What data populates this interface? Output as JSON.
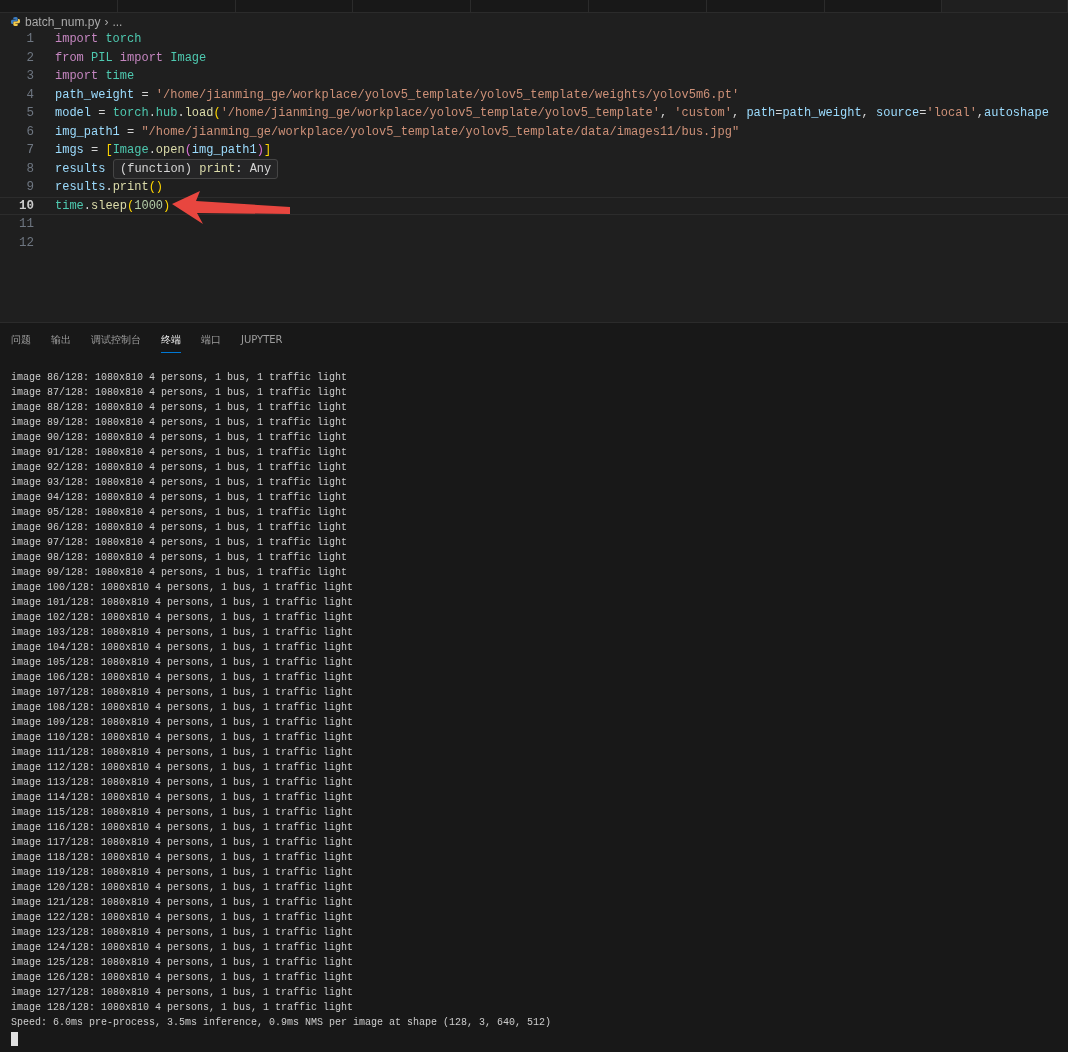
{
  "breadcrumb": {
    "file": "batch_num.py",
    "separator": "›",
    "more": "..."
  },
  "editor": {
    "lines": [
      {
        "number": "1",
        "active": false,
        "tokens": [
          {
            "text": "import ",
            "kind": "keyword"
          },
          {
            "text": "torch",
            "kind": "module"
          }
        ]
      },
      {
        "number": "2",
        "active": false,
        "tokens": [
          {
            "text": "from ",
            "kind": "keyword"
          },
          {
            "text": "PIL ",
            "kind": "module"
          },
          {
            "text": "import ",
            "kind": "keyword"
          },
          {
            "text": "Image",
            "kind": "module"
          }
        ]
      },
      {
        "number": "3",
        "active": false,
        "tokens": [
          {
            "text": "import ",
            "kind": "keyword"
          },
          {
            "text": "time",
            "kind": "module"
          }
        ]
      },
      {
        "number": "4",
        "active": false,
        "tokens": [
          {
            "text": "path_weight",
            "kind": "variable"
          },
          {
            "text": " = ",
            "kind": "plain"
          },
          {
            "text": "'/home/jianming_ge/workplace/yolov5_template/yolov5_template/weights/yolov5m6.pt'",
            "kind": "string"
          }
        ]
      },
      {
        "number": "5",
        "active": false,
        "tokens": [
          {
            "text": "model",
            "kind": "variable"
          },
          {
            "text": " = ",
            "kind": "plain"
          },
          {
            "text": "torch",
            "kind": "module"
          },
          {
            "text": ".",
            "kind": "plain"
          },
          {
            "text": "hub",
            "kind": "module"
          },
          {
            "text": ".",
            "kind": "plain"
          },
          {
            "text": "load",
            "kind": "function"
          },
          {
            "text": "(",
            "kind": "bracket"
          },
          {
            "text": "'/home/jianming_ge/workplace/yolov5_template/yolov5_template'",
            "kind": "string"
          },
          {
            "text": ", ",
            "kind": "plain"
          },
          {
            "text": "'custom'",
            "kind": "string"
          },
          {
            "text": ", ",
            "kind": "plain"
          },
          {
            "text": "path",
            "kind": "variable"
          },
          {
            "text": "=",
            "kind": "plain"
          },
          {
            "text": "path_weight",
            "kind": "variable"
          },
          {
            "text": ", ",
            "kind": "plain"
          },
          {
            "text": "source",
            "kind": "variable"
          },
          {
            "text": "=",
            "kind": "plain"
          },
          {
            "text": "'local'",
            "kind": "string"
          },
          {
            "text": ",",
            "kind": "plain"
          },
          {
            "text": "autoshape",
            "kind": "variable"
          }
        ]
      },
      {
        "number": "6",
        "active": false,
        "tokens": [
          {
            "text": "img_path1",
            "kind": "variable"
          },
          {
            "text": " = ",
            "kind": "plain"
          },
          {
            "text": "\"/home/jianming_ge/workplace/yolov5_template/yolov5_template/data/images11/bus.jpg\"",
            "kind": "string"
          }
        ]
      },
      {
        "number": "7",
        "active": false,
        "tokens": [
          {
            "text": "imgs",
            "kind": "variable"
          },
          {
            "text": " = ",
            "kind": "plain"
          },
          {
            "text": "[",
            "kind": "bracket"
          },
          {
            "text": "Image",
            "kind": "module"
          },
          {
            "text": ".",
            "kind": "plain"
          },
          {
            "text": "open",
            "kind": "function"
          },
          {
            "text": "(",
            "kind": "bracket2"
          },
          {
            "text": "img_path1",
            "kind": "variable"
          },
          {
            "text": ")",
            "kind": "bracket2"
          },
          {
            "text": "]",
            "kind": "bracket"
          }
        ]
      },
      {
        "number": "8",
        "active": false,
        "tokens": [
          {
            "text": "results",
            "kind": "variable"
          }
        ]
      },
      {
        "number": "9",
        "active": false,
        "tokens": [
          {
            "text": "results",
            "kind": "variable"
          },
          {
            "text": ".",
            "kind": "plain"
          },
          {
            "text": "print",
            "kind": "function"
          },
          {
            "text": "()",
            "kind": "bracket"
          }
        ]
      },
      {
        "number": "10",
        "active": true,
        "tokens": [
          {
            "text": "time",
            "kind": "module"
          },
          {
            "text": ".",
            "kind": "plain"
          },
          {
            "text": "sleep",
            "kind": "function"
          },
          {
            "text": "(",
            "kind": "bracket"
          },
          {
            "text": "1000",
            "kind": "number"
          },
          {
            "text": ")",
            "kind": "bracket"
          }
        ]
      },
      {
        "number": "11",
        "active": false
      },
      {
        "number": "12",
        "active": false
      }
    ]
  },
  "hover_tooltip": {
    "tokens": [
      {
        "text": "(function) ",
        "kind": "plain"
      },
      {
        "text": "print",
        "kind": "function"
      },
      {
        "text": ": Any",
        "kind": "plain"
      }
    ]
  },
  "panel": {
    "tabs": [
      {
        "label": "问题",
        "selected": false
      },
      {
        "label": "输出",
        "selected": false
      },
      {
        "label": "调试控制台",
        "selected": false
      },
      {
        "label": "终端",
        "selected": true
      },
      {
        "label": "端口",
        "selected": false
      },
      {
        "label": "JUPYTER",
        "selected": false
      }
    ]
  },
  "terminal": {
    "lines": [
      "image 86/128: 1080x810 4 persons, 1 bus, 1 traffic light",
      "image 87/128: 1080x810 4 persons, 1 bus, 1 traffic light",
      "image 88/128: 1080x810 4 persons, 1 bus, 1 traffic light",
      "image 89/128: 1080x810 4 persons, 1 bus, 1 traffic light",
      "image 90/128: 1080x810 4 persons, 1 bus, 1 traffic light",
      "image 91/128: 1080x810 4 persons, 1 bus, 1 traffic light",
      "image 92/128: 1080x810 4 persons, 1 bus, 1 traffic light",
      "image 93/128: 1080x810 4 persons, 1 bus, 1 traffic light",
      "image 94/128: 1080x810 4 persons, 1 bus, 1 traffic light",
      "image 95/128: 1080x810 4 persons, 1 bus, 1 traffic light",
      "image 96/128: 1080x810 4 persons, 1 bus, 1 traffic light",
      "image 97/128: 1080x810 4 persons, 1 bus, 1 traffic light",
      "image 98/128: 1080x810 4 persons, 1 bus, 1 traffic light",
      "image 99/128: 1080x810 4 persons, 1 bus, 1 traffic light",
      "image 100/128: 1080x810 4 persons, 1 bus, 1 traffic light",
      "image 101/128: 1080x810 4 persons, 1 bus, 1 traffic light",
      "image 102/128: 1080x810 4 persons, 1 bus, 1 traffic light",
      "image 103/128: 1080x810 4 persons, 1 bus, 1 traffic light",
      "image 104/128: 1080x810 4 persons, 1 bus, 1 traffic light",
      "image 105/128: 1080x810 4 persons, 1 bus, 1 traffic light",
      "image 106/128: 1080x810 4 persons, 1 bus, 1 traffic light",
      "image 107/128: 1080x810 4 persons, 1 bus, 1 traffic light",
      "image 108/128: 1080x810 4 persons, 1 bus, 1 traffic light",
      "image 109/128: 1080x810 4 persons, 1 bus, 1 traffic light",
      "image 110/128: 1080x810 4 persons, 1 bus, 1 traffic light",
      "image 111/128: 1080x810 4 persons, 1 bus, 1 traffic light",
      "image 112/128: 1080x810 4 persons, 1 bus, 1 traffic light",
      "image 113/128: 1080x810 4 persons, 1 bus, 1 traffic light",
      "image 114/128: 1080x810 4 persons, 1 bus, 1 traffic light",
      "image 115/128: 1080x810 4 persons, 1 bus, 1 traffic light",
      "image 116/128: 1080x810 4 persons, 1 bus, 1 traffic light",
      "image 117/128: 1080x810 4 persons, 1 bus, 1 traffic light",
      "image 118/128: 1080x810 4 persons, 1 bus, 1 traffic light",
      "image 119/128: 1080x810 4 persons, 1 bus, 1 traffic light",
      "image 120/128: 1080x810 4 persons, 1 bus, 1 traffic light",
      "image 121/128: 1080x810 4 persons, 1 bus, 1 traffic light",
      "image 122/128: 1080x810 4 persons, 1 bus, 1 traffic light",
      "image 123/128: 1080x810 4 persons, 1 bus, 1 traffic light",
      "image 124/128: 1080x810 4 persons, 1 bus, 1 traffic light",
      "image 125/128: 1080x810 4 persons, 1 bus, 1 traffic light",
      "image 126/128: 1080x810 4 persons, 1 bus, 1 traffic light",
      "image 127/128: 1080x810 4 persons, 1 bus, 1 traffic light",
      "image 128/128: 1080x810 4 persons, 1 bus, 1 traffic light",
      "Speed: 6.0ms pre-process, 3.5ms inference, 0.9ms NMS per image at shape (128, 3, 640, 512)"
    ]
  }
}
